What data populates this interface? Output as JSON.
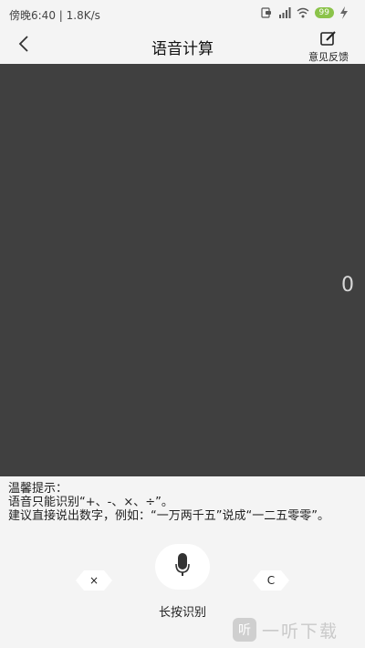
{
  "status_bar": {
    "left_text": "傍晚6:40 | 1.8K/s",
    "battery": "99"
  },
  "header": {
    "title": "语音计算",
    "feedback_label": "意见反馈",
    "back_icon": "chevron-left-icon",
    "feedback_icon": "edit-icon"
  },
  "display": {
    "value": "0",
    "background": "#404040"
  },
  "hint": {
    "line1": "温馨提示：",
    "line2": "语音只能识别“+、-、×、÷”。",
    "line3": "建议直接说出数字，例如：“一万两千五”说成“一二五零零”。"
  },
  "controls": {
    "left_button_label": "×",
    "right_button_label": "C",
    "mic_label": "长按识别",
    "mic_icon": "microphone-icon"
  },
  "watermark": {
    "logo_char": "听",
    "text": "一听下载"
  }
}
